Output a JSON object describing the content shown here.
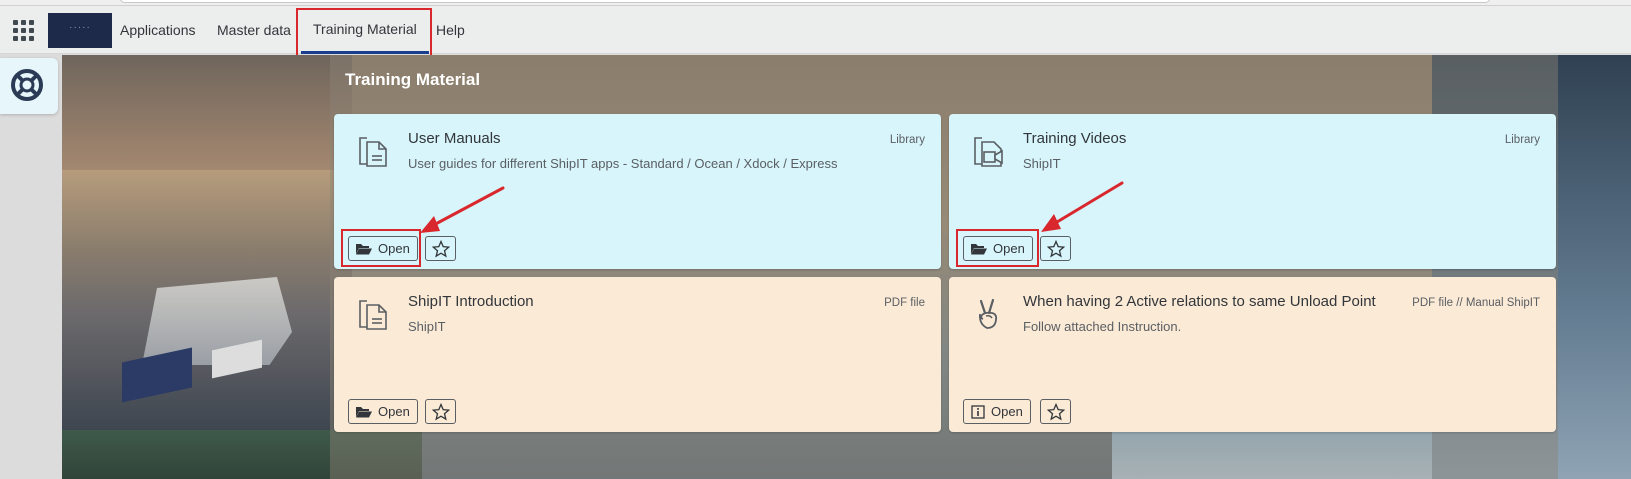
{
  "shell": {
    "logo_text": "·····",
    "tabs": [
      {
        "label": "Applications"
      },
      {
        "label": "Master data"
      },
      {
        "label": "Training Material"
      },
      {
        "label": "Help"
      }
    ],
    "active_tab": "Training Material"
  },
  "section": {
    "title": "Training Material"
  },
  "cards": [
    {
      "title": "User Manuals",
      "description": "User guides for different ShipIT apps - Standard / Ocean / Xdock / Express",
      "type": "Library",
      "icon": "document-icon",
      "button_label": "Open",
      "button_icon": "folder-open-icon",
      "color": "#d7f5fa"
    },
    {
      "title": "Training Videos",
      "description": "ShipIT",
      "type": "Library",
      "icon": "video-icon",
      "button_label": "Open",
      "button_icon": "folder-open-icon",
      "color": "#d7f5fa"
    },
    {
      "title": "ShipIT Introduction",
      "description": "ShipIT",
      "type": "PDF file",
      "icon": "document-icon",
      "button_label": "Open",
      "button_icon": "folder-open-icon",
      "color": "#fbead6"
    },
    {
      "title": "When having 2 Active relations to same Unload Point",
      "description": "Follow attached Instruction.",
      "type": "PDF file // Manual ShipIT",
      "icon": "peace-hand-icon",
      "button_label": "Open",
      "button_icon": "info-icon",
      "color": "#fbead6"
    }
  ],
  "colors": {
    "accent": "#1a3e8c",
    "highlight": "#d9272e",
    "card_blue": "#d7f5fa",
    "card_cream": "#fbead6"
  }
}
